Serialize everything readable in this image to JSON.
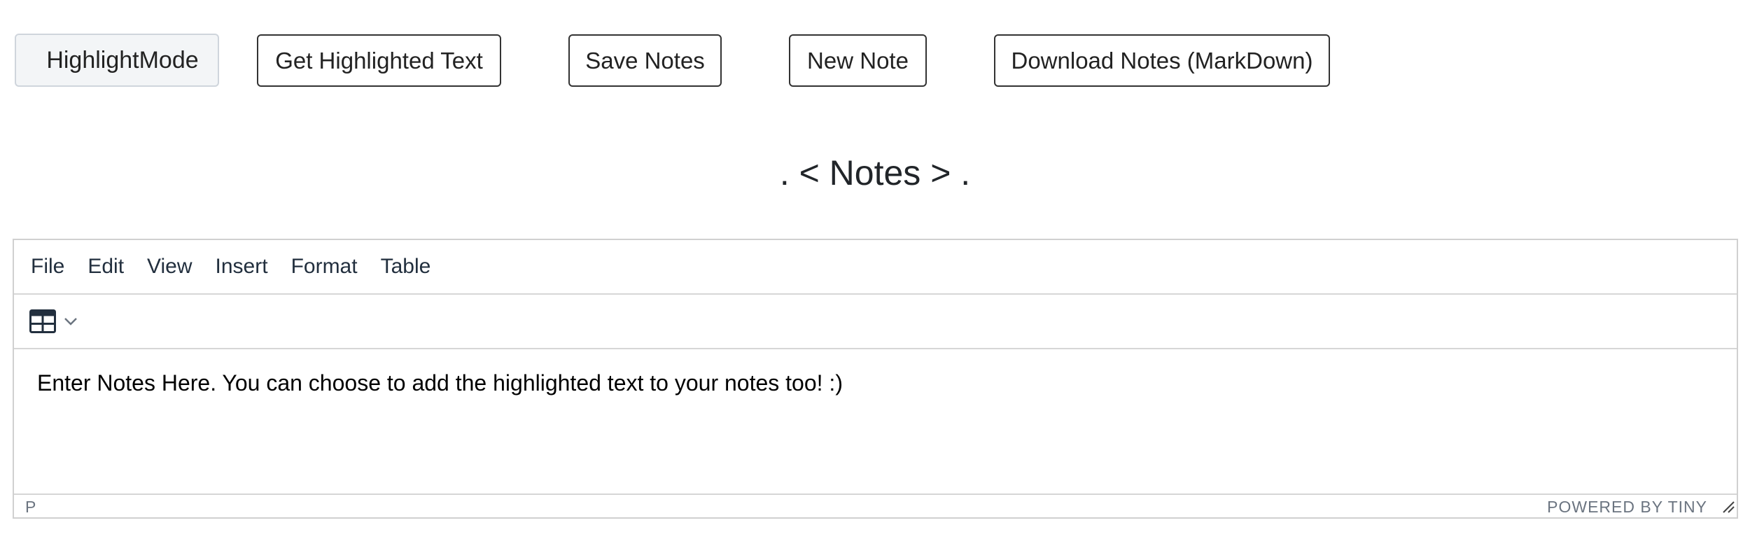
{
  "buttons": {
    "highlight_mode": "HighlightMode",
    "get_highlighted": "Get Highlighted Text",
    "save_notes": "Save Notes",
    "new_note": "New Note",
    "download_notes": "Download Notes (MarkDown)"
  },
  "notes_title": ". < Notes > .",
  "editor": {
    "menubar": [
      "File",
      "Edit",
      "View",
      "Insert",
      "Format",
      "Table"
    ],
    "toolbar": {
      "table_icon": "table-icon",
      "dropdown_icon": "chevron-down-icon"
    },
    "content": "Enter Notes Here. You can choose to add the highlighted text to your notes too! :)",
    "statusbar": {
      "path": "P",
      "branding": "POWERED BY TINY"
    }
  },
  "colors": {
    "text_dark": "#222f3e",
    "border": "#d0d0d0",
    "status_text": "#6b7480",
    "highlight_btn_bg": "#f3f5f7"
  }
}
